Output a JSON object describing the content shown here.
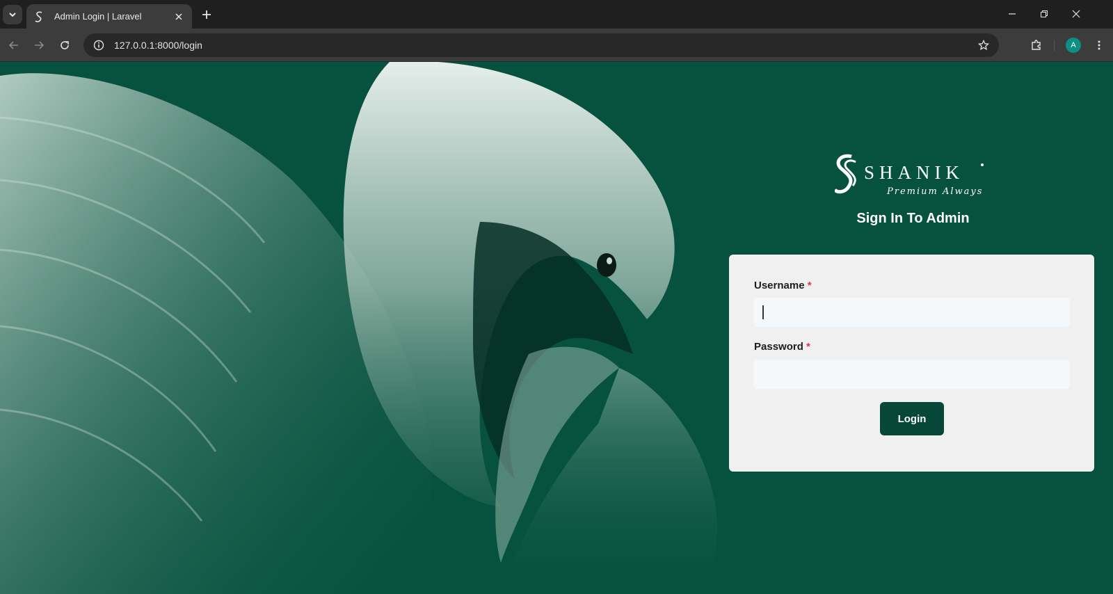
{
  "browser": {
    "tab_title": "Admin Login | Laravel",
    "url": "127.0.0.1:8000/login",
    "profile_initial": "A"
  },
  "brand": {
    "name": "SHANIK",
    "tagline": "Premium Always"
  },
  "login": {
    "heading": "Sign In To Admin",
    "username_label": "Username",
    "password_label": "Password",
    "required_mark": "*",
    "username_value": "",
    "password_value": "",
    "submit_label": "Login"
  },
  "colors": {
    "background": "#07523f",
    "card": "#f0f0f0",
    "button": "#06473a",
    "required": "#e0334b"
  }
}
